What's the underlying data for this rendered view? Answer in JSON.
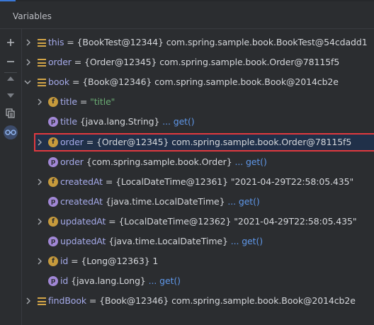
{
  "panel": {
    "title": "Variables"
  },
  "sidebar": {
    "icons": [
      "plus-icon",
      "minus-icon",
      "arrow-up-icon",
      "arrow-down-icon",
      "copy-icon",
      "watch-glasses-icon"
    ]
  },
  "rows": [
    {
      "id": "this",
      "name": "this",
      "sep": " = ",
      "value": "{BookTest@12344} com.spring.sample.book.BookTest@54cdadd1"
    },
    {
      "id": "order",
      "name": "order",
      "sep": " = ",
      "value": "{Order@12345} com.spring.sample.book.Order@78115f5"
    },
    {
      "id": "book",
      "name": "book",
      "sep": " = ",
      "value": "{Book@12346} com.spring.sample.book.Book@2014cb2e"
    },
    {
      "id": "book-title",
      "name": "title",
      "sep": " = ",
      "value": "\"title\""
    },
    {
      "id": "book-title-prop",
      "name": "title",
      "type": "{java.lang.String}",
      "link": "... get()"
    },
    {
      "id": "book-order",
      "name": "order",
      "sep": " = ",
      "value": "{Order@12345} com.spring.sample.book.Order@78115f5"
    },
    {
      "id": "book-order-prop",
      "name": "order",
      "type": "{com.spring.sample.book.Order}",
      "link": "... get()"
    },
    {
      "id": "book-createdAt",
      "name": "createdAt",
      "sep": " = ",
      "value": "{LocalDateTime@12361} \"2021-04-29T22:58:05.435\""
    },
    {
      "id": "book-createdAt-prop",
      "name": "createdAt",
      "type": "{java.time.LocalDateTime}",
      "link": "... get()"
    },
    {
      "id": "book-updatedAt",
      "name": "updatedAt",
      "sep": " = ",
      "value": "{LocalDateTime@12362} \"2021-04-29T22:58:05.435\""
    },
    {
      "id": "book-updatedAt-prop",
      "name": "updatedAt",
      "type": "{java.time.LocalDateTime}",
      "link": "... get()"
    },
    {
      "id": "book-id",
      "name": "id",
      "sep": " = ",
      "value": "{Long@12363} 1"
    },
    {
      "id": "book-id-prop",
      "name": "id",
      "type": "{java.lang.Long}",
      "link": "... get()"
    },
    {
      "id": "findBook",
      "name": "findBook",
      "sep": " = ",
      "value": "{Book@12346} com.spring.sample.book.Book@2014cb2e"
    }
  ],
  "badges": {
    "field": "f",
    "property": "p"
  },
  "colors": {
    "background": "#2b2d30",
    "name": "#a4a9e8",
    "string": "#6aab73",
    "link": "#5f97e8",
    "highlight_border": "#e0393e",
    "field_badge": "#c69a3c",
    "property_badge": "#a187d6"
  }
}
